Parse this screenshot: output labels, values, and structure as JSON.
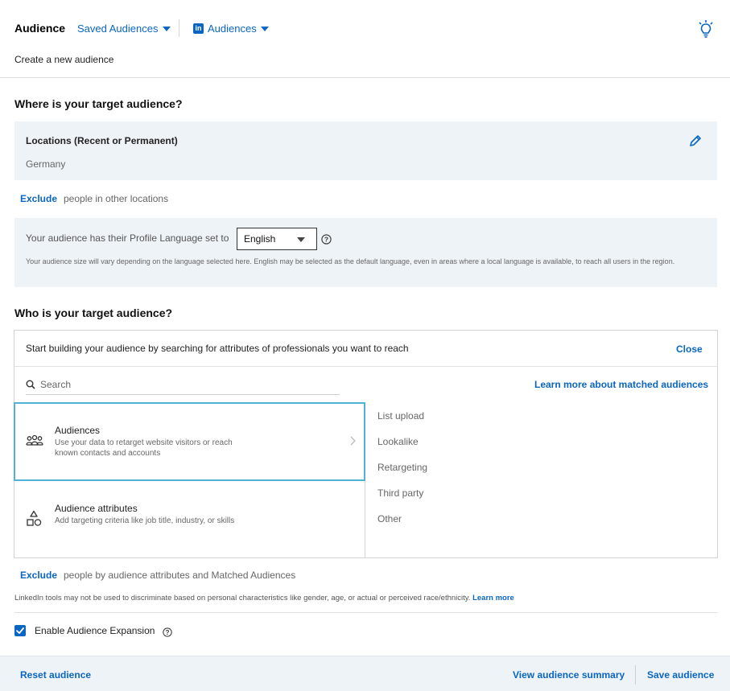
{
  "header": {
    "title": "Audience",
    "saved_audiences": "Saved Audiences",
    "linkedin_audiences": "Audiences",
    "create_new": "Create a new audience"
  },
  "where": {
    "heading": "Where is your target audience?",
    "locations_label": "Locations (Recent or Permanent)",
    "location_value": "Germany",
    "exclude_link": "Exclude",
    "exclude_text": "people in other locations"
  },
  "language": {
    "prefix": "Your audience has their Profile Language set to",
    "selected": "English",
    "note": "Your audience size will vary depending on the language selected here. English may be selected as the default language, even in areas where a local language is available, to reach all users in the region."
  },
  "who": {
    "heading": "Who is your target audience?",
    "start_text": "Start building your audience by searching for attributes of professionals you want to reach",
    "close": "Close",
    "search_placeholder": "Search",
    "learn_more": "Learn more about matched audiences",
    "options": [
      {
        "title": "Audiences",
        "desc": "Use your data to retarget website visitors or reach known contacts and accounts",
        "icon": "people-group-icon"
      },
      {
        "title": "Audience attributes",
        "desc": "Add targeting criteria like job title, industry, or skills",
        "icon": "shapes-icon"
      }
    ],
    "sub_items": [
      "List upload",
      "Lookalike",
      "Retargeting",
      "Third party",
      "Other"
    ]
  },
  "exclusion": {
    "exclude_link": "Exclude",
    "exclude_text": "people by audience attributes and Matched Audiences"
  },
  "disclaimer": {
    "text": "LinkedIn tools may not be used to discriminate based on personal characteristics like gender, age, or actual or perceived race/ethnicity.",
    "link": "Learn more"
  },
  "expansion": {
    "label": "Enable Audience Expansion",
    "checked": true
  },
  "footer": {
    "reset": "Reset audience",
    "view_summary": "View audience summary",
    "save": "Save audience"
  },
  "colors": {
    "accent": "#0a66c2",
    "selected_border": "#4fb2d6",
    "panel_bg": "#eef3f8"
  }
}
